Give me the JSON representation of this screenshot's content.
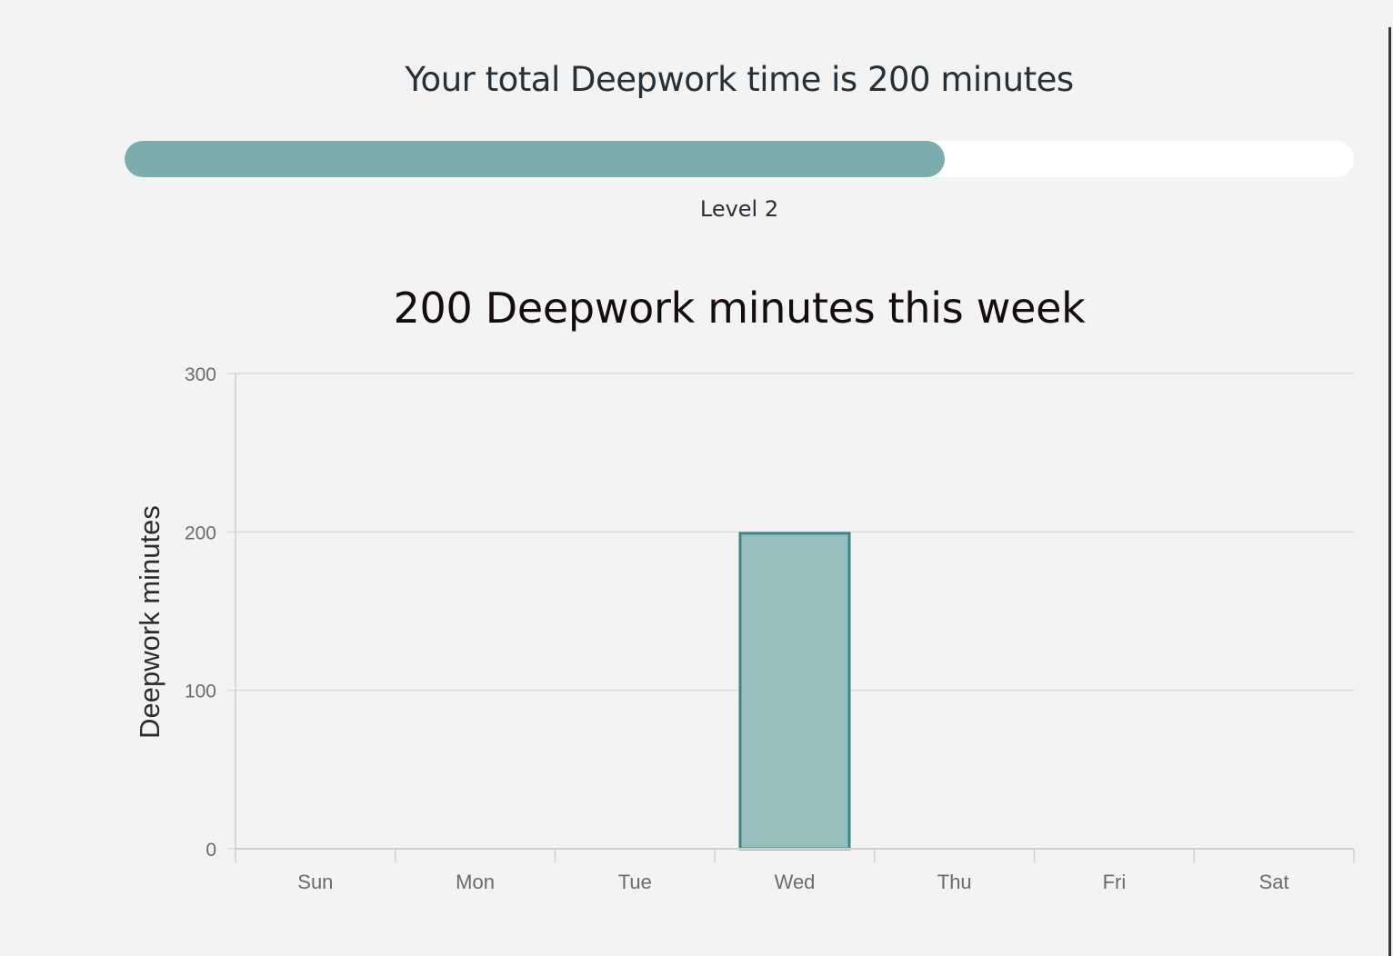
{
  "header": {
    "total_title": "Your total Deepwork time is 200 minutes"
  },
  "progress": {
    "fraction": 0.667,
    "level_label": "Level 2",
    "fill_color": "#7aadad",
    "track_color": "#ffffff"
  },
  "chart_data": {
    "type": "bar",
    "title": "200 Deepwork minutes this week",
    "xlabel": "",
    "ylabel": "Deepwork minutes",
    "categories": [
      "Sun",
      "Mon",
      "Tue",
      "Wed",
      "Thu",
      "Fri",
      "Sat"
    ],
    "values": [
      0,
      0,
      0,
      200,
      0,
      0,
      0
    ],
    "ylim": [
      0,
      300
    ],
    "yticks": [
      0,
      100,
      200,
      300
    ],
    "grid": true,
    "legend": "none",
    "bar_fill": "#98bfbf",
    "bar_border": "#3f8686"
  }
}
